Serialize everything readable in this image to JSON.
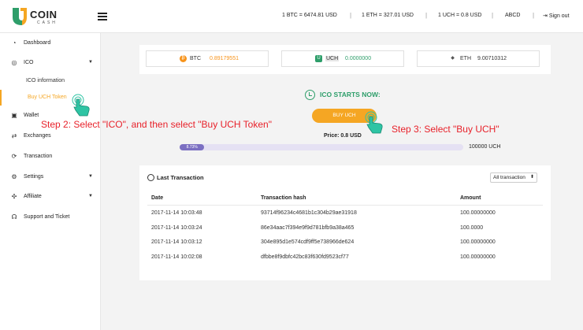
{
  "header": {
    "logo_text": "COIN",
    "logo_sub": "CASH",
    "btc_rate": "1 BTC = 6474.81 USD",
    "eth_rate": "1 ETH = 327.01 USD",
    "uch_rate": "1 UCH = 0.8 USD",
    "user": "ABCD",
    "sign_out": "Sign out",
    "separator": "|"
  },
  "sidebar": {
    "dashboard": "Dashboard",
    "ico": "ICO",
    "ico_information": "ICO information",
    "buy_uch_token": "Buy UCH Token",
    "wallet": "Wallet",
    "exchanges": "Exchanges",
    "transaction": "Transaction",
    "settings": "Settings",
    "affiliate": "Affiliate",
    "support": "Support and Ticket"
  },
  "balances": [
    {
      "name": "BTC",
      "value": "0.89179551",
      "color": "#f7931a"
    },
    {
      "name": "UCH",
      "value": "0.0000000",
      "color": "#2e9e6a"
    },
    {
      "name": "ETH",
      "value": "9.00710312",
      "color": "#333333"
    }
  ],
  "ico": {
    "title": "ICO STARTS NOW:",
    "buy_button": "BUY UCH",
    "price": "Price: 0.8 USD",
    "progress_label": "8.73%",
    "progress_percent": 8.73,
    "progress_max": "100000 UCH"
  },
  "transactions": {
    "title": "Last Transaction",
    "filter": "All transaction",
    "columns": [
      "Date",
      "Transaction hash",
      "Amount"
    ],
    "rows": [
      {
        "date": "2017-11-14 10:03:48",
        "hash": "93714f96234c4681b1c304b29ae31918",
        "amount": "100.00000000"
      },
      {
        "date": "2017-11-14 10:03:24",
        "hash": "86e34aac7f394e9f9d781bfb9a38a465",
        "amount": "100.0000"
      },
      {
        "date": "2017-11-14 10:03:12",
        "hash": "304e895d1e574cdf9ff5e738966de624",
        "amount": "100.00000000"
      },
      {
        "date": "2017-11-14 10:02:08",
        "hash": "dfbbe8f9dbfc42bc83f630fd9523cf77",
        "amount": "100.00000000"
      }
    ]
  },
  "tutorial": {
    "step2": "Step 2: Select \"ICO\", and then select \"Buy UCH Token\"",
    "step3": "Step 3: Select \"Buy UCH\""
  },
  "colors": {
    "accent": "#f5a623",
    "brand_green": "#2e9e6a",
    "progress": "#7b6fc2",
    "step_text": "#e8212a",
    "hand": "#2ec4a4"
  }
}
